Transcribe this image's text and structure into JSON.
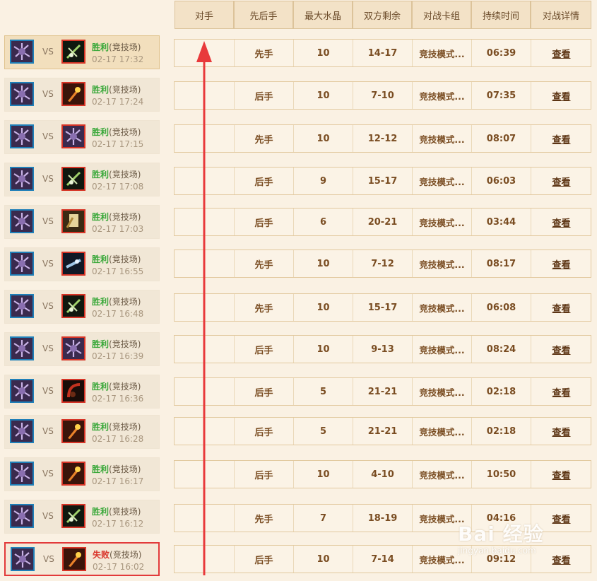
{
  "headers": [
    "对手",
    "先后手",
    "最大水晶",
    "双方剩余",
    "对战卡组",
    "持续时间",
    "对战详情"
  ],
  "matches": [
    {
      "own_hero": "warlock-hero-icon",
      "opp_hero": "hunter-hero-icon",
      "vs": "VS",
      "result": "胜利",
      "mode": "(竞技场)",
      "time": "02-17 17:32",
      "order": "先手",
      "max_crystal": "10",
      "remaining": "14-17",
      "deck": "竞技模式...",
      "duration": "06:39",
      "detail": "查看"
    },
    {
      "own_hero": "warlock-hero-icon",
      "opp_hero": "mage-hero-icon",
      "vs": "VS",
      "result": "胜利",
      "mode": "(竞技场)",
      "time": "02-17 17:24",
      "order": "后手",
      "max_crystal": "10",
      "remaining": "7-10",
      "deck": "竞技模式...",
      "duration": "07:35",
      "detail": "查看"
    },
    {
      "own_hero": "warlock-hero-icon",
      "opp_hero": "warlock-hero-icon",
      "vs": "VS",
      "result": "胜利",
      "mode": "(竞技场)",
      "time": "02-17 17:15",
      "order": "先手",
      "max_crystal": "10",
      "remaining": "12-12",
      "deck": "竞技模式...",
      "duration": "08:07",
      "detail": "查看"
    },
    {
      "own_hero": "warlock-hero-icon",
      "opp_hero": "hunter-hero-icon",
      "vs": "VS",
      "result": "胜利",
      "mode": "(竞技场)",
      "time": "02-17 17:08",
      "order": "后手",
      "max_crystal": "9",
      "remaining": "15-17",
      "deck": "竞技模式...",
      "duration": "06:03",
      "detail": "查看"
    },
    {
      "own_hero": "warlock-hero-icon",
      "opp_hero": "paladin-hero-icon",
      "vs": "VS",
      "result": "胜利",
      "mode": "(竞技场)",
      "time": "02-17 17:03",
      "order": "后手",
      "max_crystal": "6",
      "remaining": "20-21",
      "deck": "竞技模式...",
      "duration": "03:44",
      "detail": "查看"
    },
    {
      "own_hero": "warlock-hero-icon",
      "opp_hero": "shaman-hero-icon",
      "vs": "VS",
      "result": "胜利",
      "mode": "(竞技场)",
      "time": "02-17 16:55",
      "order": "先手",
      "max_crystal": "10",
      "remaining": "7-12",
      "deck": "竞技模式...",
      "duration": "08:17",
      "detail": "查看"
    },
    {
      "own_hero": "warlock-hero-icon",
      "opp_hero": "hunter-hero-icon",
      "vs": "VS",
      "result": "胜利",
      "mode": "(竞技场)",
      "time": "02-17 16:48",
      "order": "先手",
      "max_crystal": "10",
      "remaining": "15-17",
      "deck": "竞技模式...",
      "duration": "06:08",
      "detail": "查看"
    },
    {
      "own_hero": "warlock-hero-icon",
      "opp_hero": "warlock-hero-icon",
      "vs": "VS",
      "result": "胜利",
      "mode": "(竞技场)",
      "time": "02-17 16:39",
      "order": "后手",
      "max_crystal": "10",
      "remaining": "9-13",
      "deck": "竞技模式...",
      "duration": "08:24",
      "detail": "查看"
    },
    {
      "own_hero": "warlock-hero-icon",
      "opp_hero": "warrior-hero-icon",
      "vs": "VS",
      "result": "胜利",
      "mode": "(竞技场)",
      "time": "02-17 16:36",
      "order": "后手",
      "max_crystal": "5",
      "remaining": "21-21",
      "deck": "竞技模式...",
      "duration": "02:18",
      "detail": "查看"
    },
    {
      "own_hero": "warlock-hero-icon",
      "opp_hero": "mage-hero-icon",
      "vs": "VS",
      "result": "胜利",
      "mode": "(竞技场)",
      "time": "02-17 16:28",
      "order": "后手",
      "max_crystal": "5",
      "remaining": "21-21",
      "deck": "竞技模式...",
      "duration": "02:18",
      "detail": "查看"
    },
    {
      "own_hero": "warlock-hero-icon",
      "opp_hero": "mage-hero-icon",
      "vs": "VS",
      "result": "胜利",
      "mode": "(竞技场)",
      "time": "02-17 16:17",
      "order": "后手",
      "max_crystal": "10",
      "remaining": "4-10",
      "deck": "竞技模式...",
      "duration": "10:50",
      "detail": "查看"
    },
    {
      "own_hero": "warlock-hero-icon",
      "opp_hero": "hunter-hero-icon",
      "vs": "VS",
      "result": "胜利",
      "mode": "(竞技场)",
      "time": "02-17 16:12",
      "order": "先手",
      "max_crystal": "7",
      "remaining": "18-19",
      "deck": "竞技模式...",
      "duration": "04:16",
      "detail": "查看"
    },
    {
      "own_hero": "warlock-hero-icon",
      "opp_hero": "mage-hero-icon",
      "vs": "VS",
      "result": "失败",
      "mode": "(竞技场)",
      "time": "02-17 16:02",
      "order": "后手",
      "max_crystal": "10",
      "remaining": "7-14",
      "deck": "竞技模式...",
      "duration": "09:12",
      "detail": "查看"
    }
  ],
  "watermark": {
    "logo": "Bai 经验",
    "url": "jingyan.baidu.com"
  },
  "colors": {
    "win": "#3aa83a",
    "lose": "#d9342a",
    "arrow": "#e8393b",
    "own_border": "#1f7fb8",
    "opp_border": "#d63426"
  }
}
